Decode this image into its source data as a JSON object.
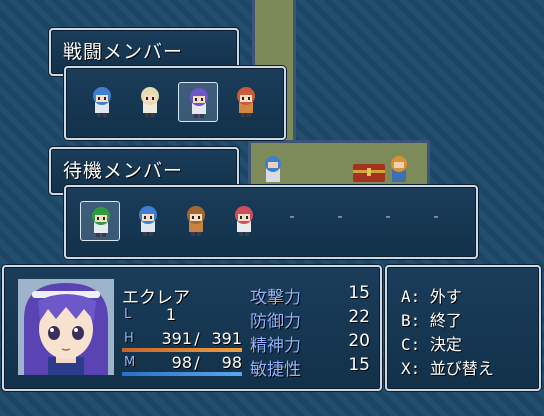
{
  "battle_window": {
    "title": "戦闘メンバー"
  },
  "battle_members": [
    {
      "name": "blue-hair-knight",
      "hair": "#3f7fd0",
      "cloth": "#dfe6ee"
    },
    {
      "name": "blonde-hair-girl",
      "hair": "#e7dcb0",
      "cloth": "#efe9de"
    },
    {
      "name": "purple-hair-girl",
      "hair": "#6c58c8",
      "cloth": "#e6e8f0",
      "selected": true
    },
    {
      "name": "red-hair-girl",
      "hair": "#c95a3a",
      "cloth": "#d3873f"
    }
  ],
  "reserve_window": {
    "title": "待機メンバー"
  },
  "reserve_members": [
    {
      "name": "green-hair-boy",
      "hair": "#2f9a3f",
      "cloth": "#e4ecf2",
      "selected": true
    },
    {
      "name": "blue-hair-boy",
      "hair": "#3f7fd0",
      "cloth": "#dfe6ee"
    },
    {
      "name": "brown-hair-girl",
      "hair": "#a2682f",
      "cloth": "#c9823f"
    },
    {
      "name": "pink-hair-girl",
      "hair": "#d04e5a",
      "cloth": "#e9ecef"
    }
  ],
  "empty_slot_text": "-",
  "status": {
    "name": "エクレア",
    "level_label": "L",
    "level": "1",
    "hp_label": "H",
    "hp": "391",
    "hp_max": "391",
    "mp_label": "M",
    "mp": "98",
    "mp_max": "98",
    "hp_ratio": 1.0,
    "mp_ratio": 1.0,
    "stats": [
      {
        "name": "攻撃力",
        "value": "15"
      },
      {
        "name": "防御力",
        "value": "22"
      },
      {
        "name": "精神力",
        "value": "20"
      },
      {
        "name": "敏捷性",
        "value": "15"
      }
    ]
  },
  "commands": [
    {
      "key": "A:",
      "label": "外す"
    },
    {
      "key": "B:",
      "label": "終了"
    },
    {
      "key": "C:",
      "label": "決定"
    },
    {
      "key": "X:",
      "label": "並び替え"
    }
  ],
  "colors": {
    "window_bg": "#163853",
    "stat_label": "#8fb4ff",
    "hp_gauge": "#e07a2a",
    "mp_gauge": "#3b82d6"
  }
}
